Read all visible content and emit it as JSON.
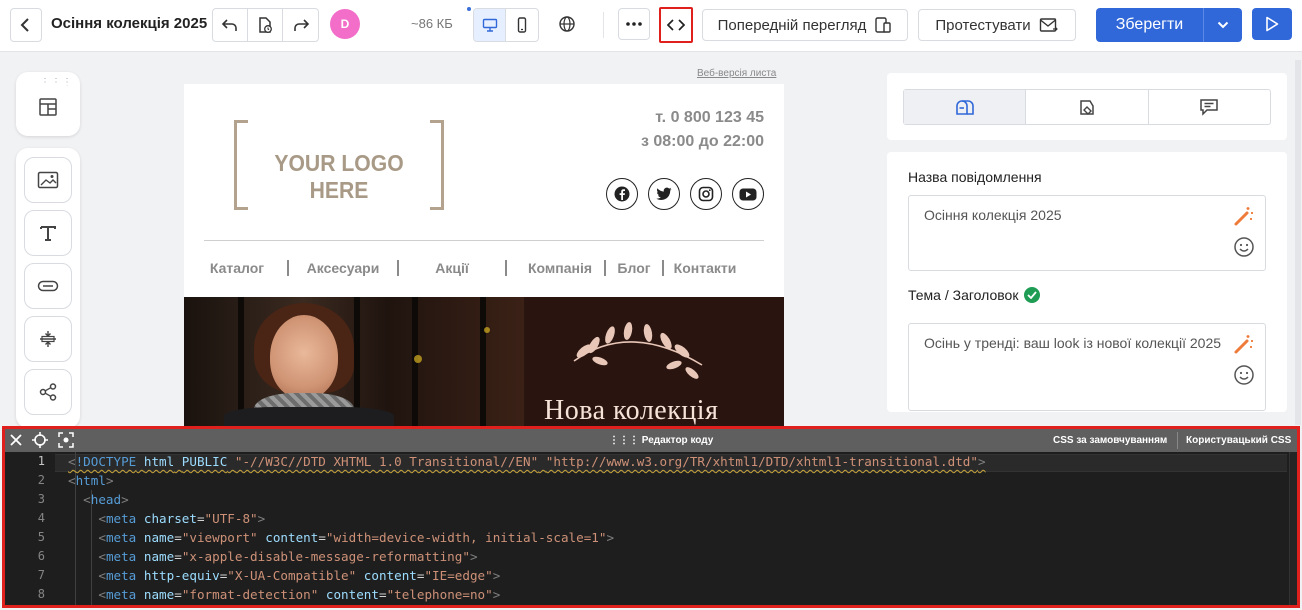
{
  "header": {
    "title": "Осіння колекція 2025",
    "avatar_initial": "D",
    "size": "~86 КБ",
    "preview_label": "Попередній перегляд",
    "test_label": "Протестувати",
    "save_label": "Зберегти"
  },
  "email": {
    "web_version": "Веб-версія листа",
    "logo_text": "YOUR LOGO HERE",
    "phone": "т. 0 800 123 45",
    "hours": "з 08:00 до 22:00",
    "nav": [
      "Каталог",
      "Аксесуари",
      "Акції",
      "Компанія",
      "Блог",
      "Контакти"
    ],
    "hero_headline": "Нова колекція"
  },
  "settings": {
    "name_label": "Назва повідомлення",
    "name_value": "Осіння колекція 2025",
    "subject_label": "Тема / Заголовок",
    "subject_value": "Осінь у тренді: ваш look із нової колекції 2025"
  },
  "code_editor": {
    "title": "Редактор коду",
    "css_default": "CSS за замовчуванням",
    "css_custom": "Користувацький CSS",
    "line_numbers": [
      "1",
      "2",
      "3",
      "4",
      "5",
      "6",
      "7",
      "8"
    ]
  },
  "colors": {
    "accent": "#3168d9",
    "highlight_border": "#e0201c",
    "avatar": "#f26ec8"
  }
}
